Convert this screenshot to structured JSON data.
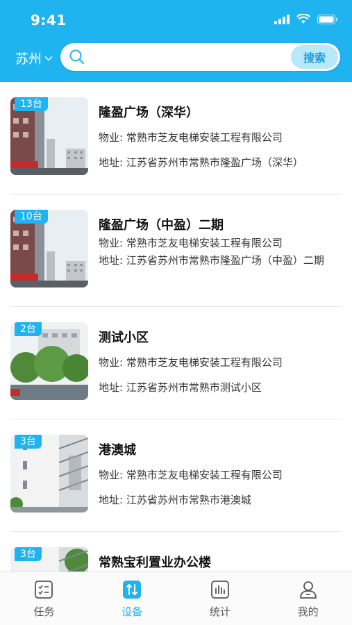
{
  "status_bar": {
    "time": "9:41"
  },
  "header": {
    "city": "苏州",
    "search": {
      "placeholder": "",
      "button_label": "搜索"
    }
  },
  "colors": {
    "primary": "#1fb3f0",
    "search_button_bg": "#b9e8fb"
  },
  "properties": [
    {
      "count_badge": "13台",
      "name": "隆盈广场（深华）",
      "property": "物业: 常熟市芝友电梯安装工程有限公司",
      "address": "地址: 江苏省苏州市常熟市隆盈广场（深华）",
      "thumb_icon": "building-photo"
    },
    {
      "count_badge": "10台",
      "name": "隆盈广场（中盈）二期",
      "property": "物业: 常熟市芝友电梯安装工程有限公司",
      "address": "地址: 江苏省苏州市常熟市隆盈广场（中盈）二期",
      "thumb_icon": "building-photo"
    },
    {
      "count_badge": "2台",
      "name": "测试小区",
      "property": "物业: 常熟市芝友电梯安装工程有限公司",
      "address": "地址: 江苏省苏州市常熟市测试小区",
      "thumb_icon": "trees-building-photo"
    },
    {
      "count_badge": "3台",
      "name": "港澳城",
      "property": "物业: 常熟市芝友电梯安装工程有限公司",
      "address": "地址: 江苏省苏州市常熟市港澳城",
      "thumb_icon": "white-building-photo"
    },
    {
      "count_badge": "3台",
      "name": "常熟宝利置业办公楼",
      "property": "",
      "address": "",
      "thumb_icon": "white-building-photo"
    }
  ],
  "tabbar": [
    {
      "label": "任务",
      "icon": "task-checklist-icon",
      "active": false
    },
    {
      "label": "设备",
      "icon": "device-arrows-icon",
      "active": true
    },
    {
      "label": "统计",
      "icon": "statistics-chart-icon",
      "active": false
    },
    {
      "label": "我的",
      "icon": "profile-person-icon",
      "active": false
    }
  ]
}
